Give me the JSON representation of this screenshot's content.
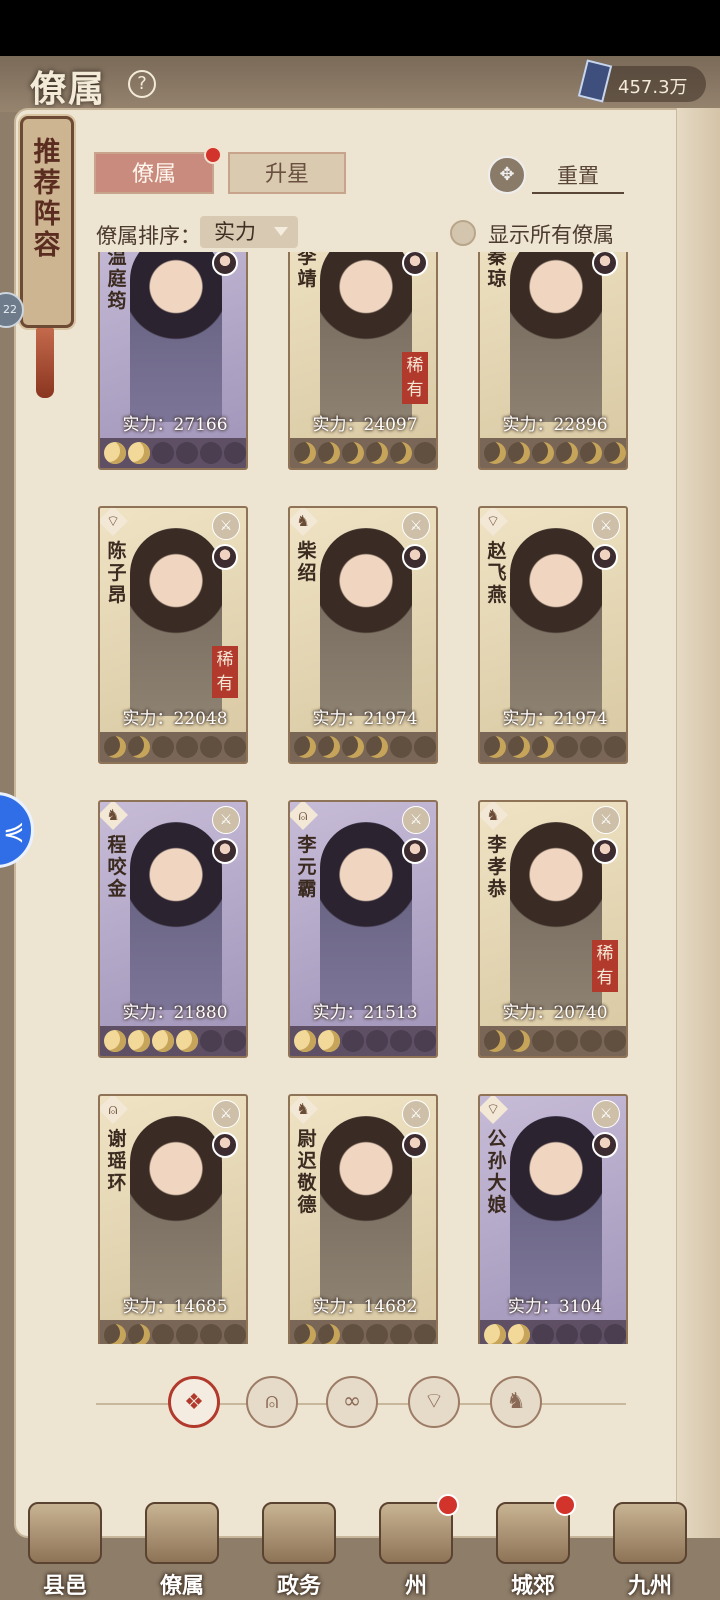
{
  "header": {
    "title": "僚属",
    "help_icon": "question-circle-icon",
    "currency_icon": "blue-scroll-icon",
    "currency_value": "457.3万"
  },
  "side": {
    "recommend_label": "推荐阵容",
    "badge_text": "22",
    "float_button_icon": "wifi-signal-icon"
  },
  "tabs": [
    {
      "label": "僚属",
      "active": true,
      "badge": true
    },
    {
      "label": "升星",
      "active": false,
      "badge": false
    }
  ],
  "reset_label": "重置",
  "sort": {
    "label": "僚属排序：",
    "selected": "实力"
  },
  "show_all_label": "显示所有僚属",
  "cards": [
    {
      "name": "温庭筠",
      "power": "实力：27166",
      "rarity": "",
      "frame": "purple",
      "stars": 2,
      "class_icon": "fan-icon"
    },
    {
      "name": "李靖",
      "power": "实力：24097",
      "rarity": "稀有",
      "frame": "gold",
      "stars": 5,
      "class_icon": "fan-icon"
    },
    {
      "name": "秦琼",
      "power": "实力：22896",
      "rarity": "",
      "frame": "gold",
      "stars": 6,
      "class_icon": "fan-icon"
    },
    {
      "name": "陈子昂",
      "power": "实力：22048",
      "rarity": "稀有",
      "frame": "gold",
      "stars": 2,
      "class_icon": "fan-icon"
    },
    {
      "name": "柴绍",
      "power": "实力：21974",
      "rarity": "",
      "frame": "gold",
      "stars": 4,
      "class_icon": "tiger-icon"
    },
    {
      "name": "赵飞燕",
      "power": "实力：21974",
      "rarity": "",
      "frame": "gold",
      "stars": 3,
      "class_icon": "fan-icon"
    },
    {
      "name": "程咬金",
      "power": "实力：21880",
      "rarity": "",
      "frame": "purple",
      "stars": 4,
      "class_icon": "tiger-icon"
    },
    {
      "name": "李元霸",
      "power": "实力：21513",
      "rarity": "",
      "frame": "purple",
      "stars": 2,
      "class_icon": "bell-icon"
    },
    {
      "name": "李孝恭",
      "power": "实力：20740",
      "rarity": "稀有",
      "frame": "gold",
      "stars": 2,
      "class_icon": "tiger-icon"
    },
    {
      "name": "谢瑶环",
      "power": "实力：14685",
      "rarity": "",
      "frame": "gold",
      "stars": 2,
      "class_icon": "bell-icon"
    },
    {
      "name": "尉迟敬德",
      "power": "实力：14682",
      "rarity": "",
      "frame": "gold",
      "stars": 2,
      "class_icon": "tiger-icon"
    },
    {
      "name": "公孙大娘",
      "power": "实力：3104",
      "rarity": "",
      "frame": "purple",
      "stars": 2,
      "class_icon": "fan-icon"
    }
  ],
  "filters": [
    {
      "icon": "all-icon",
      "active": true
    },
    {
      "icon": "bell-icon",
      "active": false
    },
    {
      "icon": "gourd-icon",
      "active": false
    },
    {
      "icon": "fan-icon",
      "active": false
    },
    {
      "icon": "tiger-icon",
      "active": false
    }
  ],
  "nav": [
    {
      "label": "县邑",
      "badge": false
    },
    {
      "label": "僚属",
      "badge": false
    },
    {
      "label": "政务",
      "badge": false
    },
    {
      "label": "州",
      "badge": true
    },
    {
      "label": "城郊",
      "badge": true
    },
    {
      "label": "九州",
      "badge": false
    }
  ]
}
